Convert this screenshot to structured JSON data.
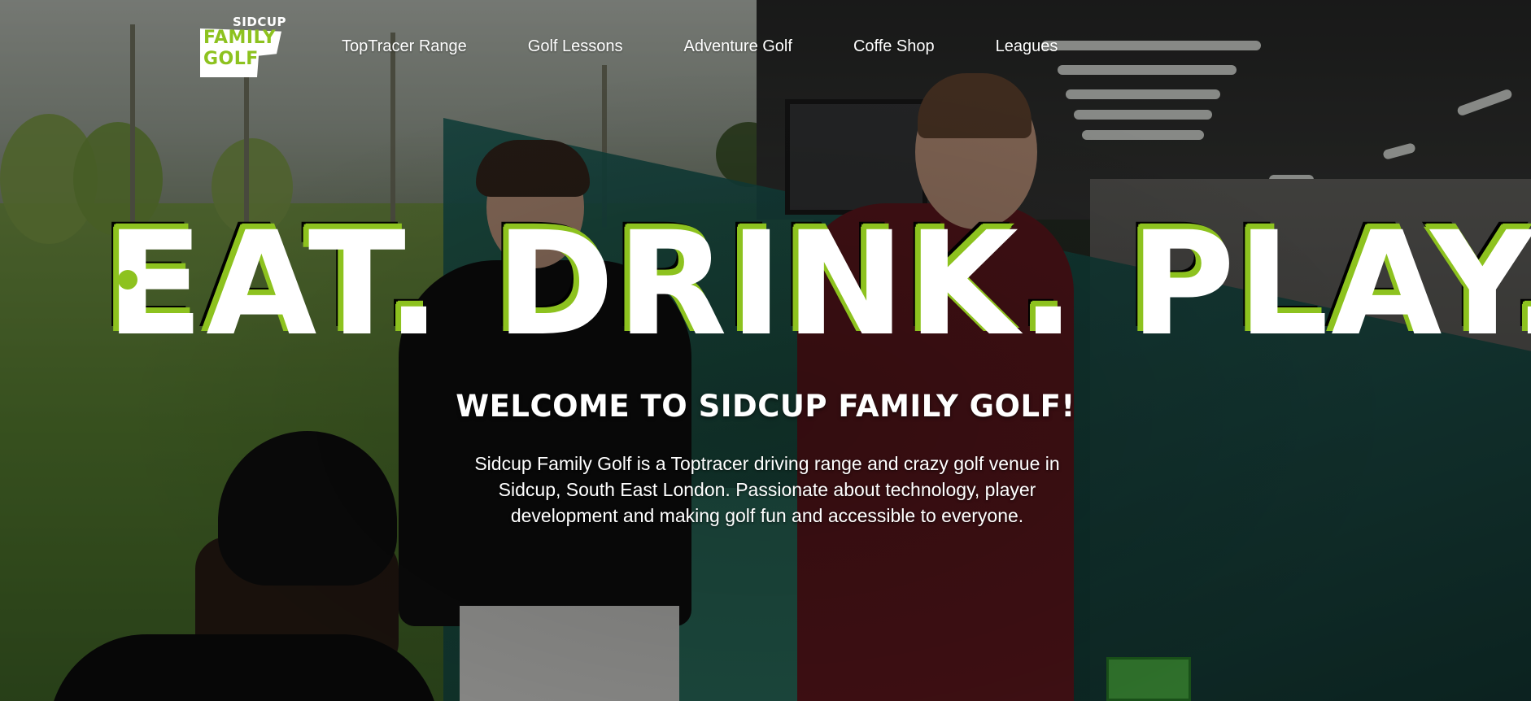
{
  "brand": {
    "small": "SIDCUP",
    "line1": "FAMILY",
    "line2": "GOLF",
    "accent_color": "#8dc21f"
  },
  "nav": {
    "items": [
      {
        "label": "TopTracer Range"
      },
      {
        "label": "Golf Lessons"
      },
      {
        "label": "Adventure Golf"
      },
      {
        "label": "Coffe Shop"
      },
      {
        "label": "Leagues"
      }
    ]
  },
  "hero": {
    "headline": "EAT. DRINK. PLAY.",
    "welcome": "WELCOME TO SIDCUP FAMILY GOLF!",
    "intro": "Sidcup Family Golf is a Toptracer driving range and crazy golf venue in Sidcup, South East London. Passionate about technology, player development and making golf fun and accessible to everyone."
  }
}
